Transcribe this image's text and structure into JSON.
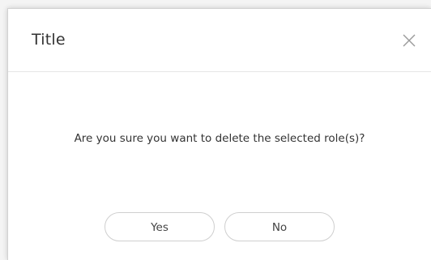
{
  "dialog": {
    "title": "Title",
    "close_icon": "close-icon",
    "message": "Are you sure you want to delete the selected role(s)?",
    "buttons": {
      "yes_label": "Yes",
      "no_label": "No"
    }
  },
  "colors": {
    "text": "#333333",
    "border": "#cfcfcf",
    "divider": "#e6e6e6",
    "icon": "#9a9a9a"
  }
}
